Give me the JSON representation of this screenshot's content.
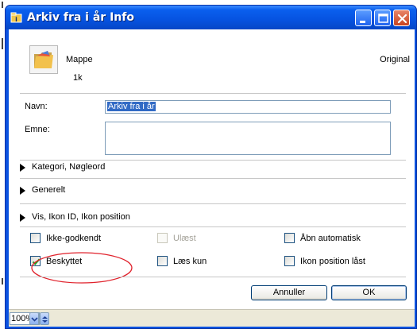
{
  "window": {
    "title": "Arkiv fra i år Info",
    "title_icon": "folder-info-icon"
  },
  "file": {
    "kind": "Mappe",
    "size": "1k",
    "original_label": "Original"
  },
  "fields": {
    "name_label": "Navn:",
    "name_value": "Arkiv fra i år",
    "subject_label": "Emne:",
    "subject_value": ""
  },
  "sections": [
    {
      "label": "Kategori, Nøgleord",
      "expanded": false
    },
    {
      "label": "Generelt",
      "expanded": false
    },
    {
      "label": "Vis, Ikon ID, Ikon position",
      "expanded": false
    }
  ],
  "checkboxes": [
    {
      "label": "Ikke-godkendt",
      "checked": false,
      "enabled": true
    },
    {
      "label": "Ulæst",
      "checked": false,
      "enabled": false
    },
    {
      "label": "Åbn automatisk",
      "checked": false,
      "enabled": true
    },
    {
      "label": "Beskyttet",
      "checked": true,
      "enabled": true
    },
    {
      "label": "Læs kun",
      "checked": false,
      "enabled": true
    },
    {
      "label": "Ikon position låst",
      "checked": false,
      "enabled": true
    }
  ],
  "buttons": {
    "cancel": "Annuller",
    "ok": "OK"
  },
  "status": {
    "zoom": "100%"
  },
  "colors": {
    "title_bar": "#0653e0",
    "annotation": "#e0202a",
    "check_mark": "#21a121"
  }
}
